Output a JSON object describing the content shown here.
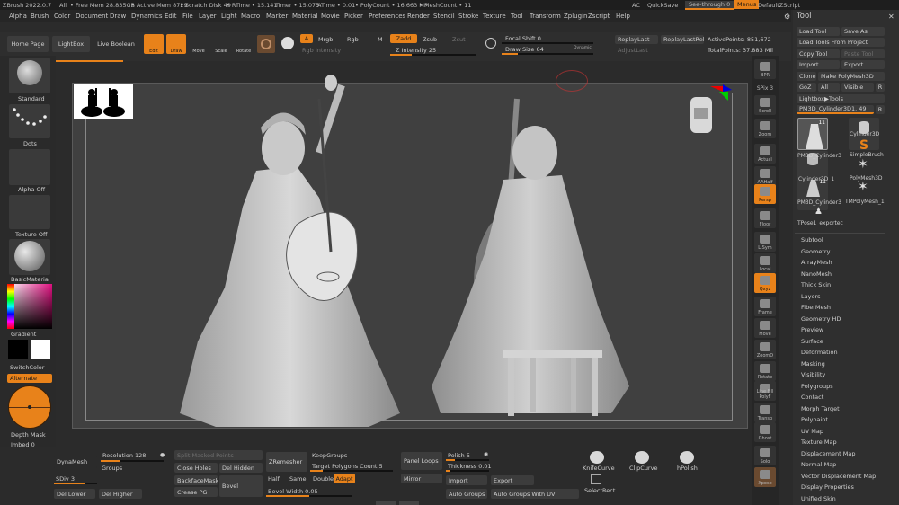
{
  "titlebar": {
    "app": "ZBrush 2022.0.7",
    "all": "All",
    "free_mem": "• Free Mem 28.835GB",
    "active_mem": "• Active Mem 8729",
    "scratch": "• Scratch Disk 49",
    "rtime": "• RTime • 15.141",
    "timer": "Timer • 15.075",
    "atime": "ATime • 0.01",
    "polycount": "• PolyCount • 16.663 MP",
    "meshcount": "• MeshCount • 11",
    "ac": "AC",
    "quicksave": "QuickSave",
    "seethrough": "See-through 0",
    "menus": "Menus",
    "default_script": "DefaultZScript"
  },
  "menubar": [
    "Alpha",
    "Brush",
    "Color",
    "Document",
    "Draw",
    "Dynamics",
    "Edit",
    "File",
    "Layer",
    "Light",
    "Macro",
    "Marker",
    "Material",
    "Movie",
    "Picker",
    "Preferences",
    "Render",
    "Stencil",
    "Stroke",
    "Texture",
    "Tool",
    "Transform",
    "Zplugin",
    "Zscript",
    "Help"
  ],
  "topshelf": {
    "home_page": "Home Page",
    "lightbox": "LightBox",
    "live_boolean": "Live Boolean",
    "edit": "Edit",
    "draw": "Draw",
    "move": "Move",
    "scale": "Scale",
    "rotate": "Rotate",
    "a": "A",
    "mrgb": "Mrgb",
    "rgb": "Rgb",
    "m": "M",
    "zadd": "Zadd",
    "zsub": "Zsub",
    "zcut": "Zcut",
    "rgb_intensity": "Rgb Intensity",
    "z_intensity": "Z Intensity 25",
    "z_intensity_value": 0.25,
    "focal_shift": "Focal Shift 0",
    "draw_size": "Draw Size 64",
    "draw_size_value": 0.18,
    "dynamic": "Dynamic",
    "replay_last": "ReplayLast",
    "replay_last_rel": "ReplayLastRel",
    "adjust_last": "AdjustLast",
    "active_points": "ActivePoints: 851,672",
    "total_points": "TotalPoints: 37.883 Mil"
  },
  "leftshelf": {
    "brush": "Standard",
    "stroke": "Dots",
    "alpha": "Alpha Off",
    "texture": "Texture Off",
    "material": "BasicMaterial",
    "gradient": "Gradient",
    "switch_color": "SwitchColor",
    "alternate": "Alternate",
    "depth_mask": "Depth Mask",
    "imbed": "Imbed 0"
  },
  "rightshelf": [
    "BPR",
    "SPix 3",
    "Scroll",
    "Zoom",
    "Actual",
    "AAHalf",
    "Persp",
    "Floor",
    "L.Sym",
    "Local",
    "Qxyz",
    "Frame",
    "Move",
    "ZoomD",
    "Rotate",
    "Line Fill PolyF",
    "Transp",
    "Ghost",
    "Solo",
    "Xpose"
  ],
  "toolpanel": {
    "title": "Tool",
    "load_tool": "Load Tool",
    "save_as": "Save As",
    "load_from_project": "Load Tools From Project",
    "copy_tool": "Copy Tool",
    "paste_tool": "Paste Tool",
    "import": "Import",
    "export": "Export",
    "clone": "Clone",
    "make_polymesh": "Make PolyMesh3D",
    "goz": "GoZ",
    "all": "All",
    "visible": "Visible",
    "r": "R",
    "lightbox_tools": "Lightbox▶Tools",
    "current_tool": "PM3D_Cylinder3D1. 49",
    "current_r": "R",
    "thumb_count_1": "11",
    "thumb_count_2": "11",
    "thumbs": [
      "PM3D_Cylinder3",
      "Cylinder3D",
      "SimpleBrush",
      "Cylinder3D_1",
      "PolyMesh3D",
      "PM3D_Cylinder3",
      "TMPolyMesh_1",
      "TPose1_exportec"
    ],
    "subpalettes": [
      "Subtool",
      "Geometry",
      "ArrayMesh",
      "NanoMesh",
      "Thick Skin",
      "Layers",
      "FiberMesh",
      "Geometry HD",
      "Preview",
      "Surface",
      "Deformation",
      "Masking",
      "Visibility",
      "Polygroups",
      "Contact",
      "Morph Target",
      "Polypaint",
      "UV Map",
      "Texture Map",
      "Displacement Map",
      "Normal Map",
      "Vector Displacement Map",
      "Display Properties",
      "Unified Skin"
    ]
  },
  "bottomshelf": {
    "dynamesh": "DynaMesh",
    "resolution": "Resolution 128",
    "resolution_value": 0.3,
    "groups": "Groups",
    "sdiv": "SDiv 3",
    "del_lower": "Del Lower",
    "del_higher": "Del Higher",
    "split_masked": "Split Masked Points",
    "close_holes": "Close Holes",
    "del_hidden": "Del Hidden",
    "backface_mask": "BackfaceMask",
    "bevel": "Bevel",
    "crease_pg": "Crease PG",
    "zremesher": "ZRemesher",
    "keep_groups": "KeepGroups",
    "target_polygons": "Target Polygons Count 5",
    "half": "Half",
    "same": "Same",
    "double": "Double",
    "adapt": "Adapt",
    "bevel_width": "Bevel Width 0.05",
    "panel_loops": "Panel Loops",
    "mirror": "Mirror",
    "polish": "Polish 5",
    "thickness": "Thickness 0.01",
    "import": "Import",
    "export": "Export",
    "auto_groups": "Auto Groups",
    "auto_groups_uv": "Auto Groups With UV",
    "knife_curve": "KnifeCurve",
    "clip_curve": "ClipCurve",
    "hpolish": "hPolish",
    "select_rect": "SelectRect"
  },
  "colors": {
    "accent": "#e8821a",
    "panel": "#2f2f2f",
    "canvas": "#404040",
    "button": "#3c3c3c"
  }
}
